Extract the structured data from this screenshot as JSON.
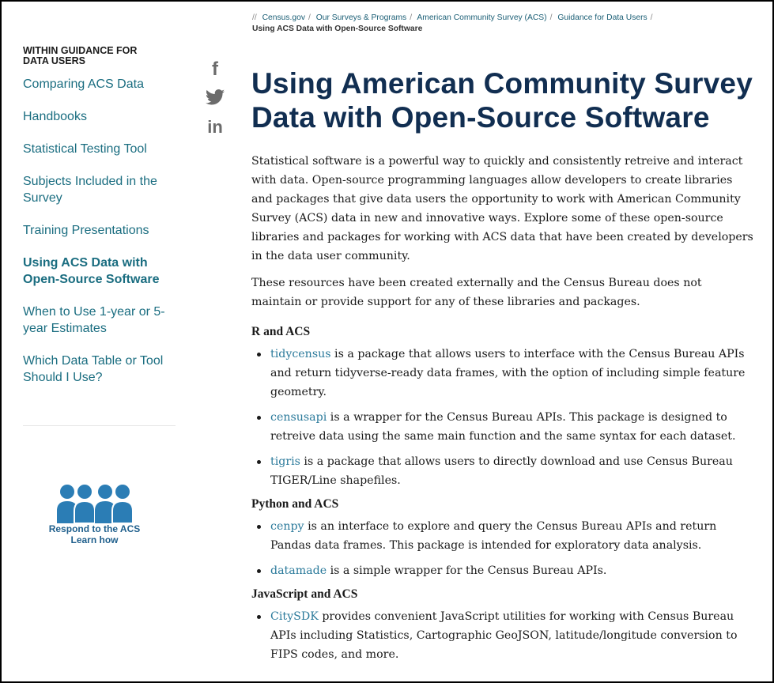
{
  "breadcrumb": {
    "lead": "//",
    "items": [
      "Census.gov",
      "Our Surveys & Programs",
      "American Community Survey (ACS)",
      "Guidance for Data Users"
    ],
    "current": "Using ACS Data with Open-Source Software"
  },
  "sidebar": {
    "heading_line1": "WITHIN GUIDANCE FOR",
    "heading_line2": "DATA USERS",
    "items": [
      {
        "line1": "Comparing ACS Data",
        "line2": ""
      },
      {
        "line1": "Handbooks",
        "line2": ""
      },
      {
        "line1": "Statistical Testing Tool",
        "line2": ""
      },
      {
        "line1": "Subjects Included in the",
        "line2": "Survey"
      },
      {
        "line1": "Training Presentations",
        "line2": ""
      },
      {
        "line1": "Using ACS Data with",
        "line2": "Open-Source Software"
      },
      {
        "line1": "When to Use 1-year or 5-",
        "line2": "year Estimates"
      },
      {
        "line1": "Which Data Table or Tool",
        "line2": "Should I Use?"
      }
    ],
    "respond_line1": "Respond to the ACS",
    "respond_line2": "Learn how"
  },
  "social": {
    "facebook_glyph": "f",
    "linkedin_glyph": "in",
    "icons": [
      "facebook-icon",
      "twitter-icon",
      "linkedin-icon"
    ]
  },
  "main": {
    "title_line1": "Using American Community Survey",
    "title_line2": "Data with Open-Source Software",
    "intro": [
      "Statistical software is a powerful way to quickly and consistently retreive and interact",
      "with data. Open-source programming languages allow developers to create libraries",
      "and packages that give data users the opportunity to work with American Community",
      "Survey (ACS) data in new and innovative ways. Explore some of these open-source",
      "libraries and packages for working with ACS data that have been created by developers",
      "in the data user community."
    ],
    "note": [
      "These resources have been created externally and the Census Bureau does not",
      "maintain or provide support for any of these libraries and packages."
    ],
    "sections": [
      {
        "heading": "R and ACS",
        "items": [
          {
            "name": "tidycensus",
            "lines": [
              " is a package that allows users to interface with the Census Bureau APIs",
              "and return tidyverse-ready data frames, with the option of including simple feature",
              "geometry."
            ]
          },
          {
            "name": "censusapi",
            "lines": [
              " is a wrapper for the Census Bureau APIs. This package is designed to",
              "retreive data using the same main function and the same syntax for each dataset."
            ]
          },
          {
            "name": "tigris",
            "lines": [
              " is a package that allows users to directly download and use Census Bureau",
              "TIGER/Line shapefiles."
            ]
          }
        ]
      },
      {
        "heading": "Python and ACS",
        "items": [
          {
            "name": "cenpy",
            "lines": [
              " is an interface to explore and query the Census Bureau APIs and return",
              "Pandas data frames. This package is intended for exploratory data analysis."
            ]
          },
          {
            "name": "datamade",
            "lines": [
              " is a simple wrapper for the Census Bureau APIs."
            ]
          }
        ]
      },
      {
        "heading": "JavaScript and ACS",
        "items": [
          {
            "name": "CitySDK",
            "lines": [
              " provides convenient JavaScript utilities for working with Census Bureau",
              "APIs including Statistics, Cartographic GeoJSON, latitude/longitude conversion to",
              "FIPS codes, and more."
            ]
          }
        ]
      }
    ]
  },
  "colors": {
    "link": "#1a6d80",
    "package_link": "#2b7a9b",
    "title": "#112e51",
    "respond_icon": "#2b7db5"
  }
}
